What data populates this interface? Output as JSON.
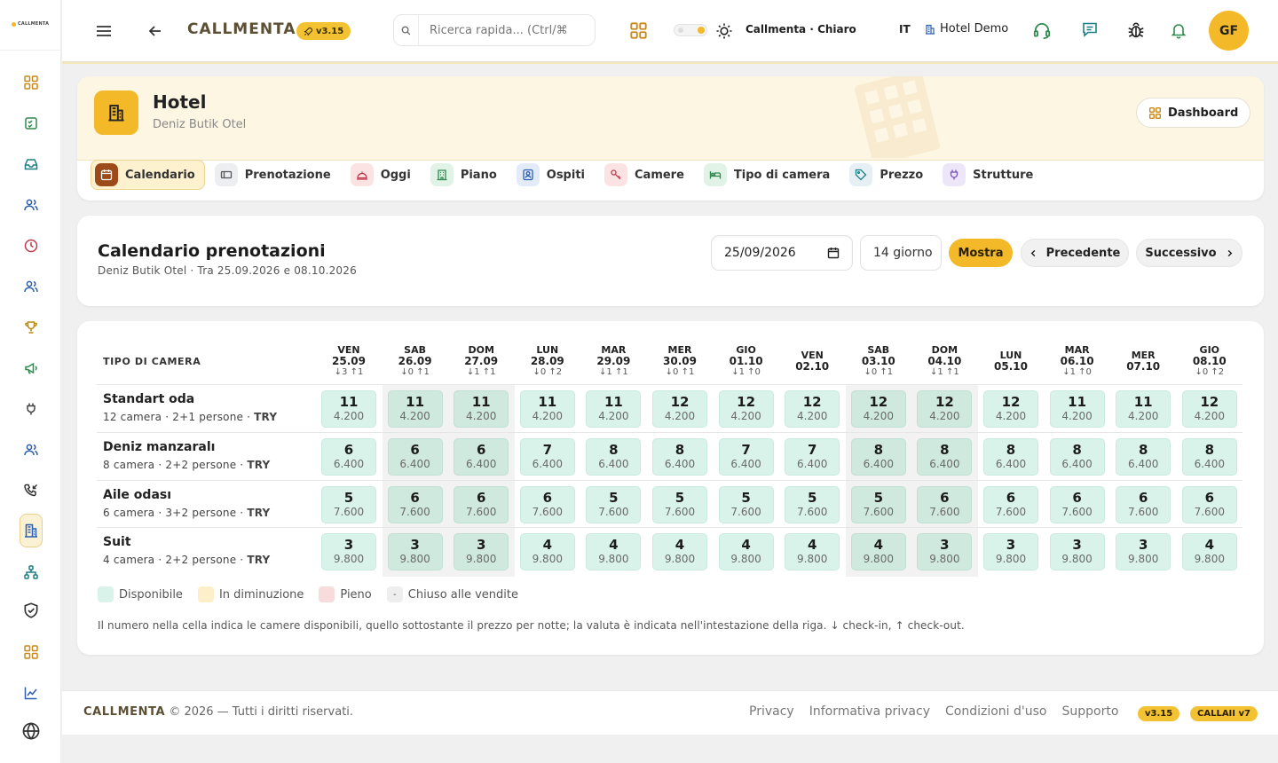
{
  "app": {
    "logo_text": "CALLMENTA",
    "brand": "CALLMENTA",
    "version": "v3.15",
    "search_placeholder": "Ricerca rapida... (Ctrl/⌘",
    "theme_label": "Callmenta · Chiaro",
    "language": "IT",
    "hotel_selector": "Hotel Demo",
    "user_initials": "GF"
  },
  "hotel": {
    "title": "Hotel",
    "subtitle": "Deniz Butik Otel",
    "dashboard_label": "Dashboard",
    "tabs": [
      {
        "label": "Calendario",
        "icon": "calendar-icon"
      },
      {
        "label": "Prenotazione",
        "icon": "card-icon"
      },
      {
        "label": "Oggi",
        "icon": "bell-service-icon"
      },
      {
        "label": "Piano",
        "icon": "building-icon"
      },
      {
        "label": "Ospiti",
        "icon": "contact-icon"
      },
      {
        "label": "Camere",
        "icon": "key-icon"
      },
      {
        "label": "Tipo di camera",
        "icon": "bed-icon"
      },
      {
        "label": "Prezzo",
        "icon": "tag-icon"
      },
      {
        "label": "Strutture",
        "icon": "facilities-icon"
      }
    ]
  },
  "calendar": {
    "title": "Calendario prenotazioni",
    "subtitle": "Deniz Butik Otel · Tra 25.09.2026 e 08.10.2026",
    "start_date": "25/09/2026",
    "days_value": "14 giorno",
    "show_label": "Mostra",
    "prev_label": "Precedente",
    "next_label": "Successivo"
  },
  "grid": {
    "type_header": "TIPO DI CAMERA",
    "days": [
      {
        "dow": "VEN",
        "date": "25.09",
        "moves": "↓3 ↑1",
        "weekend": false
      },
      {
        "dow": "SAB",
        "date": "26.09",
        "moves": "↓0 ↑1",
        "weekend": true
      },
      {
        "dow": "DOM",
        "date": "27.09",
        "moves": "↓1 ↑1",
        "weekend": true
      },
      {
        "dow": "LUN",
        "date": "28.09",
        "moves": "↓0 ↑2",
        "weekend": false
      },
      {
        "dow": "MAR",
        "date": "29.09",
        "moves": "↓1 ↑1",
        "weekend": false
      },
      {
        "dow": "MER",
        "date": "30.09",
        "moves": "↓0 ↑1",
        "weekend": false
      },
      {
        "dow": "GIO",
        "date": "01.10",
        "moves": "↓1 ↑0",
        "weekend": false
      },
      {
        "dow": "VEN",
        "date": "02.10",
        "moves": "",
        "weekend": false
      },
      {
        "dow": "SAB",
        "date": "03.10",
        "moves": "↓0 ↑1",
        "weekend": true
      },
      {
        "dow": "DOM",
        "date": "04.10",
        "moves": "↓1 ↑1",
        "weekend": true
      },
      {
        "dow": "LUN",
        "date": "05.10",
        "moves": "",
        "weekend": false
      },
      {
        "dow": "MAR",
        "date": "06.10",
        "moves": "↓1 ↑0",
        "weekend": false
      },
      {
        "dow": "MER",
        "date": "07.10",
        "moves": "",
        "weekend": false
      },
      {
        "dow": "GIO",
        "date": "08.10",
        "moves": "↓0 ↑2",
        "weekend": false
      }
    ],
    "rows": [
      {
        "name": "Standart oda",
        "rooms": "12 camera",
        "persons": "2+1 persone",
        "currency": "TRY",
        "avail": [
          "11",
          "11",
          "11",
          "11",
          "11",
          "12",
          "12",
          "12",
          "12",
          "12",
          "12",
          "11",
          "11",
          "12"
        ],
        "prices": [
          "4.200",
          "4.200",
          "4.200",
          "4.200",
          "4.200",
          "4.200",
          "4.200",
          "4.200",
          "4.200",
          "4.200",
          "4.200",
          "4.200",
          "4.200",
          "4.200"
        ]
      },
      {
        "name": "Deniz manzaralı",
        "rooms": "8 camera",
        "persons": "2+2 persone",
        "currency": "TRY",
        "avail": [
          "6",
          "6",
          "6",
          "7",
          "8",
          "8",
          "7",
          "7",
          "8",
          "8",
          "8",
          "8",
          "8",
          "8"
        ],
        "prices": [
          "6.400",
          "6.400",
          "6.400",
          "6.400",
          "6.400",
          "6.400",
          "6.400",
          "6.400",
          "6.400",
          "6.400",
          "6.400",
          "6.400",
          "6.400",
          "6.400"
        ]
      },
      {
        "name": "Aile odası",
        "rooms": "6 camera",
        "persons": "3+2 persone",
        "currency": "TRY",
        "avail": [
          "5",
          "6",
          "6",
          "6",
          "5",
          "5",
          "5",
          "5",
          "5",
          "6",
          "6",
          "6",
          "6",
          "6"
        ],
        "prices": [
          "7.600",
          "7.600",
          "7.600",
          "7.600",
          "7.600",
          "7.600",
          "7.600",
          "7.600",
          "7.600",
          "7.600",
          "7.600",
          "7.600",
          "7.600",
          "7.600"
        ]
      },
      {
        "name": "Suit",
        "rooms": "4 camera",
        "persons": "2+2 persone",
        "currency": "TRY",
        "avail": [
          "3",
          "3",
          "3",
          "4",
          "4",
          "4",
          "4",
          "4",
          "4",
          "3",
          "3",
          "3",
          "3",
          "4"
        ],
        "prices": [
          "9.800",
          "9.800",
          "9.800",
          "9.800",
          "9.800",
          "9.800",
          "9.800",
          "9.800",
          "9.800",
          "9.800",
          "9.800",
          "9.800",
          "9.800",
          "9.800"
        ]
      }
    ],
    "legend": [
      {
        "label": "Disponibile",
        "color": "#d9f3ea",
        "symbol": ""
      },
      {
        "label": "In diminuzione",
        "color": "#fcefc9",
        "symbol": ""
      },
      {
        "label": "Pieno",
        "color": "#f8dcdc",
        "symbol": ""
      },
      {
        "label": "Chiuso alle vendite",
        "color": "#eeeeee",
        "symbol": "-"
      }
    ],
    "note": "Il numero nella cella indica le camere disponibili, quello sottostante il prezzo per notte; la valuta è indicata nell'intestazione della riga. ↓ check-in, ↑ check-out."
  },
  "footer": {
    "brand": "CALLMENTA",
    "copyright": "© 2026 — Tutti i diritti riservati.",
    "links": [
      "Privacy",
      "Informativa privacy",
      "Condizioni d'uso",
      "Supporto"
    ],
    "badge1": "v3.15",
    "badge2": "CALLAII v7"
  },
  "colors": {
    "accent": "#f3b928",
    "available": "#d9f3ea",
    "brand_text": "#5b4f34"
  }
}
